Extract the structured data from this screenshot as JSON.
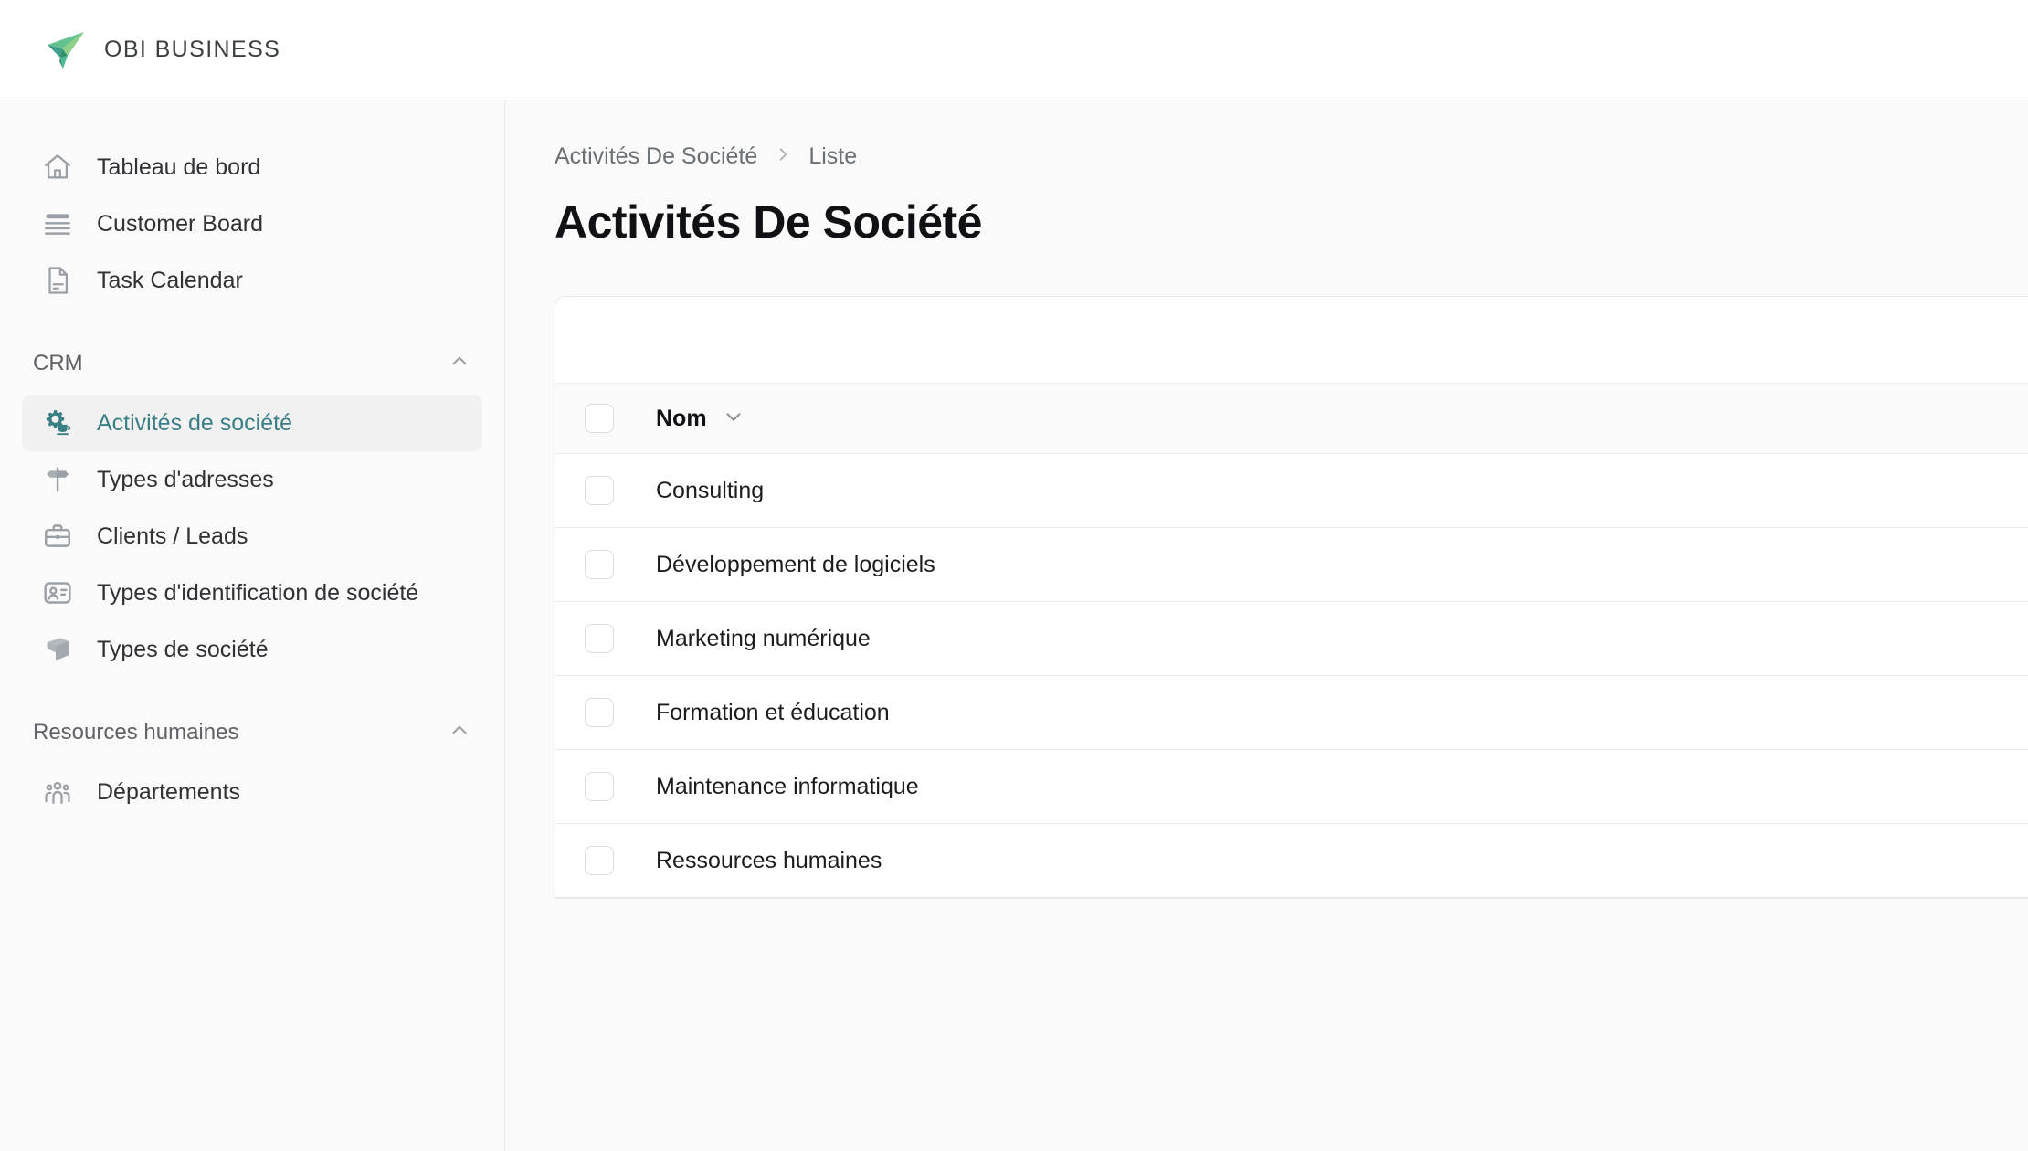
{
  "brand": {
    "name": "OBI BUSINESS",
    "logo_icon": "paper-plane-icon",
    "colors": {
      "green_light": "#8ed08a",
      "green_mid": "#4fb894",
      "green_dark": "#2f8f6a",
      "text": "#3c4043"
    }
  },
  "sidebar": {
    "top_items": [
      {
        "label": "Tableau de bord",
        "icon": "home-icon"
      },
      {
        "label": "Customer Board",
        "icon": "board-icon"
      },
      {
        "label": "Task Calendar",
        "icon": "document-icon"
      }
    ],
    "sections": [
      {
        "title": "CRM",
        "collapse_icon": "chevron-up-icon",
        "items": [
          {
            "label": "Activités de société",
            "icon": "gear-cup-icon",
            "active": true
          },
          {
            "label": "Types d'adresses",
            "icon": "signpost-icon",
            "active": false
          },
          {
            "label": "Clients / Leads",
            "icon": "briefcase-icon",
            "active": false
          },
          {
            "label": "Types d'identification de société",
            "icon": "id-card-icon",
            "active": false
          },
          {
            "label": "Types de société",
            "icon": "box-icon",
            "active": false
          }
        ]
      },
      {
        "title": "Resources humaines",
        "collapse_icon": "chevron-up-icon",
        "items": [
          {
            "label": "Départements",
            "icon": "people-group-icon",
            "active": false
          }
        ]
      }
    ],
    "active_color": "#3a7f85",
    "active_background": "#f1f1f1"
  },
  "breadcrumb": {
    "root": "Activités De Société",
    "separator_icon": "chevron-right-icon",
    "current": "Liste"
  },
  "page": {
    "title": "Activités De Société"
  },
  "table": {
    "select_all_checkbox": "unchecked",
    "columns": [
      {
        "label": "Nom",
        "sort_icon": "chevron-down-icon"
      }
    ],
    "rows": [
      {
        "checkbox": "unchecked",
        "nom": "Consulting"
      },
      {
        "checkbox": "unchecked",
        "nom": "Développement de logiciels"
      },
      {
        "checkbox": "unchecked",
        "nom": "Marketing numérique"
      },
      {
        "checkbox": "unchecked",
        "nom": "Formation et éducation"
      },
      {
        "checkbox": "unchecked",
        "nom": "Maintenance informatique"
      },
      {
        "checkbox": "unchecked",
        "nom": "Ressources humaines"
      }
    ]
  }
}
